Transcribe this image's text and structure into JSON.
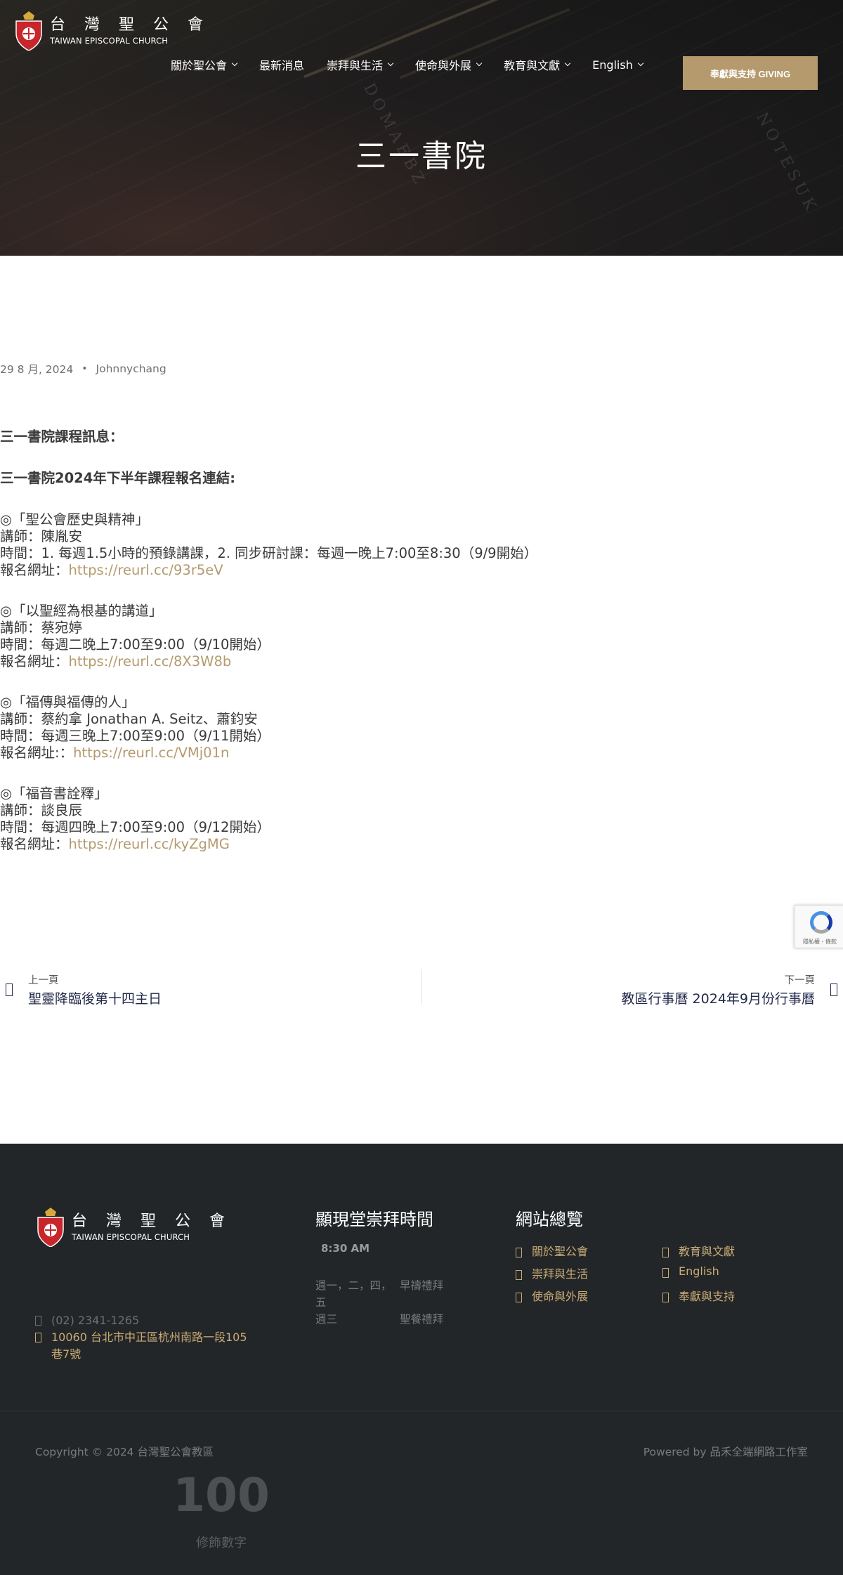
{
  "header": {
    "logo_cn": "台 灣 聖 公 會",
    "logo_en": "TAIWAN EPISCOPAL CHURCH",
    "nav": [
      {
        "label": "關於聖公會",
        "dropdown": true
      },
      {
        "label": "最新消息",
        "dropdown": false
      },
      {
        "label": "崇拜與生活",
        "dropdown": true
      },
      {
        "label": "使命與外展",
        "dropdown": true
      },
      {
        "label": "教育與文獻",
        "dropdown": true
      },
      {
        "label": "English",
        "dropdown": true
      }
    ],
    "giving_button": "奉獻與支持 GIVING",
    "page_title": "三一書院",
    "accent_color": "#b59a6e"
  },
  "post": {
    "date": "29 8 月, 2024",
    "author": "Johnnychang",
    "heading1": "三一書院課程訊息：",
    "heading2": "三一書院2024年下半年課程報名連結:",
    "courses": [
      {
        "title": "◎「聖公會歷史與精神」",
        "teacher": "講師：陳胤安",
        "time": "時間：1. 每週1.5小時的預錄講課，2. 同步研討課：每週一晚上7:00至8:30（9/9開始）",
        "link_label": "報名網址：",
        "link": "https://reurl.cc/93r5eV"
      },
      {
        "title": "◎「以聖經為根基的講道」",
        "teacher": "講師：蔡宛婷",
        "time": "時間：每週二晚上7:00至9:00（9/10開始）",
        "link_label": "報名網址：",
        "link": "https://reurl.cc/8X3W8b"
      },
      {
        "title": "◎「福傳與福傳的人」",
        "teacher": "講師：蔡約拿 Jonathan A. Seitz、蕭鈞安",
        "time": "時間：每週三晚上7:00至9:00（9/11開始）",
        "link_label": "報名網址:：",
        "link": "https://reurl.cc/VMj01n"
      },
      {
        "title": "◎「福音書詮釋」",
        "teacher": "講師：談良辰",
        "time": "時間：每週四晚上7:00至9:00（9/12開始）",
        "link_label": "報名網址：",
        "link": "https://reurl.cc/kyZgMG"
      }
    ]
  },
  "post_nav": {
    "prev_label": "上一頁",
    "prev_title": "聖靈降臨後第十四主日",
    "next_label": "下一頁",
    "next_title": "教區行事曆 2024年9月份行事曆"
  },
  "recaptcha": {
    "text": "隱私權 - 條款"
  },
  "footer": {
    "logo_cn": "台 灣 聖 公 會",
    "logo_en": "TAIWAN EPISCOPAL CHURCH",
    "phone": "(02) 2341-1265",
    "address": "10060 台北市中正區杭州南路一段105巷7號",
    "worship_title": "顯現堂崇拜時間",
    "worship_time": "8:30 AM",
    "worship_rows": [
      {
        "days": "週一，二，四，五",
        "type": "早禱禮拜"
      },
      {
        "days": "週三",
        "type": "聖餐禮拜"
      }
    ],
    "sitemap_title": "網站總覽",
    "sitemap": [
      "關於聖公會",
      "教育與文獻",
      "崇拜與生活",
      "English",
      "使命與外展",
      "奉獻與支持"
    ],
    "copyright": "Copyright © 2024 台灣聖公會教區",
    "powered": "Powered by 品禾全端網路工作室",
    "counter_value": "100",
    "counter_label": "修飾數字"
  }
}
